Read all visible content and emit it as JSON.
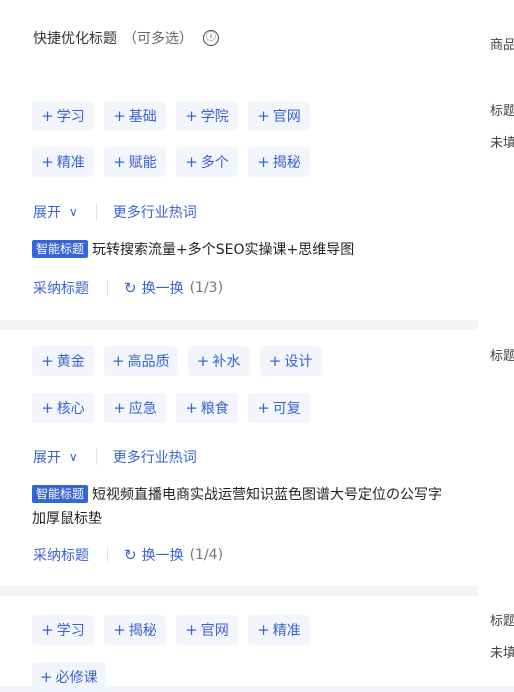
{
  "header": {
    "title": "快捷优化标题",
    "subtitle": "（可多选）",
    "info_icon": "ⓘ"
  },
  "sections": [
    {
      "tag_rows": [
        [
          "学习",
          "基础",
          "学院",
          "官网"
        ],
        [
          "精准",
          "赋能",
          "多个",
          "揭秘"
        ]
      ],
      "expand_label": "展开",
      "more_label": "更多行业热词",
      "smart_badge": "智能标题",
      "smart_text": "玩转搜索流量+多个SEO实操课+思维导图",
      "adopt_label": "采纳标题",
      "refresh_label": "换一换",
      "refresh_count": "(1/3)"
    },
    {
      "tag_rows": [
        [
          "黄金",
          "高品质",
          "补水",
          "设计"
        ],
        [
          "核心",
          "应急",
          "粮食",
          "可复"
        ]
      ],
      "expand_label": "展开",
      "more_label": "更多行业热词",
      "smart_badge": "智能标题",
      "smart_text": "短视频直播电商实战运营知识蓝色图谱大号定位の公写字加厚鼠标垫",
      "adopt_label": "采纳标题",
      "refresh_label": "换一换",
      "refresh_count": "(1/4)"
    },
    {
      "tag_rows": [
        [
          "学习",
          "揭秘",
          "官网",
          "精准"
        ],
        [
          "必修课"
        ]
      ]
    }
  ],
  "right_column": [
    "商品",
    "标题",
    "未填",
    "标题",
    "标题",
    "未填"
  ]
}
